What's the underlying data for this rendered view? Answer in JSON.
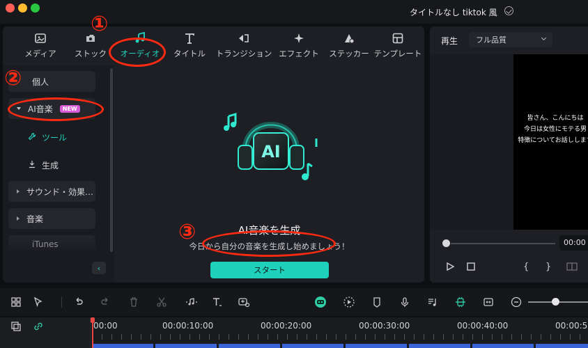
{
  "window": {
    "title": "タイトルなし tiktok 風"
  },
  "tabs": [
    {
      "label": "メディア",
      "icon": "media-icon"
    },
    {
      "label": "ストック",
      "icon": "stock-icon"
    },
    {
      "label": "オーディオ",
      "icon": "music-note-icon",
      "active": true
    },
    {
      "label": "タイトル",
      "icon": "title-t-icon"
    },
    {
      "label": "トランジション",
      "icon": "transition-icon"
    },
    {
      "label": "エフェクト",
      "icon": "sparkle-icon"
    },
    {
      "label": "ステッカー",
      "icon": "sticker-icon"
    },
    {
      "label": "テンプレート",
      "icon": "template-icon"
    }
  ],
  "sidebar": {
    "personal": "個人",
    "ai_music": "AI音楽",
    "new_badge": "NEW",
    "tool": "ツール",
    "generate": "生成",
    "sound_effects": "サウンド・効果…",
    "music": "音楽",
    "itunes": "iTunes"
  },
  "content": {
    "title": "AI音楽を生成",
    "subtitle": "今日から自分の音楽を生成し始めましょう！",
    "start_button": "スタート",
    "graphic_label": "AI"
  },
  "preview": {
    "label": "再生",
    "quality": "フル品質",
    "caption_lines": [
      "皆さん、こんにちは",
      "今日は女性にモテる男",
      "特徴についてお話しします"
    ],
    "time": "00:00",
    "mark_in": "{",
    "mark_out": "}"
  },
  "timeline": {
    "ruler_labels": [
      "00:00",
      "00:00:10:00",
      "00:00:20:00",
      "00:00:30:00",
      "00:00:40:00",
      "00:00:5"
    ]
  },
  "annotations": {
    "one": "①",
    "two": "②",
    "three": "③"
  },
  "colors": {
    "accent": "#22d3bf",
    "annotation": "#ff2a12",
    "new_badge": "#d65bd6"
  }
}
